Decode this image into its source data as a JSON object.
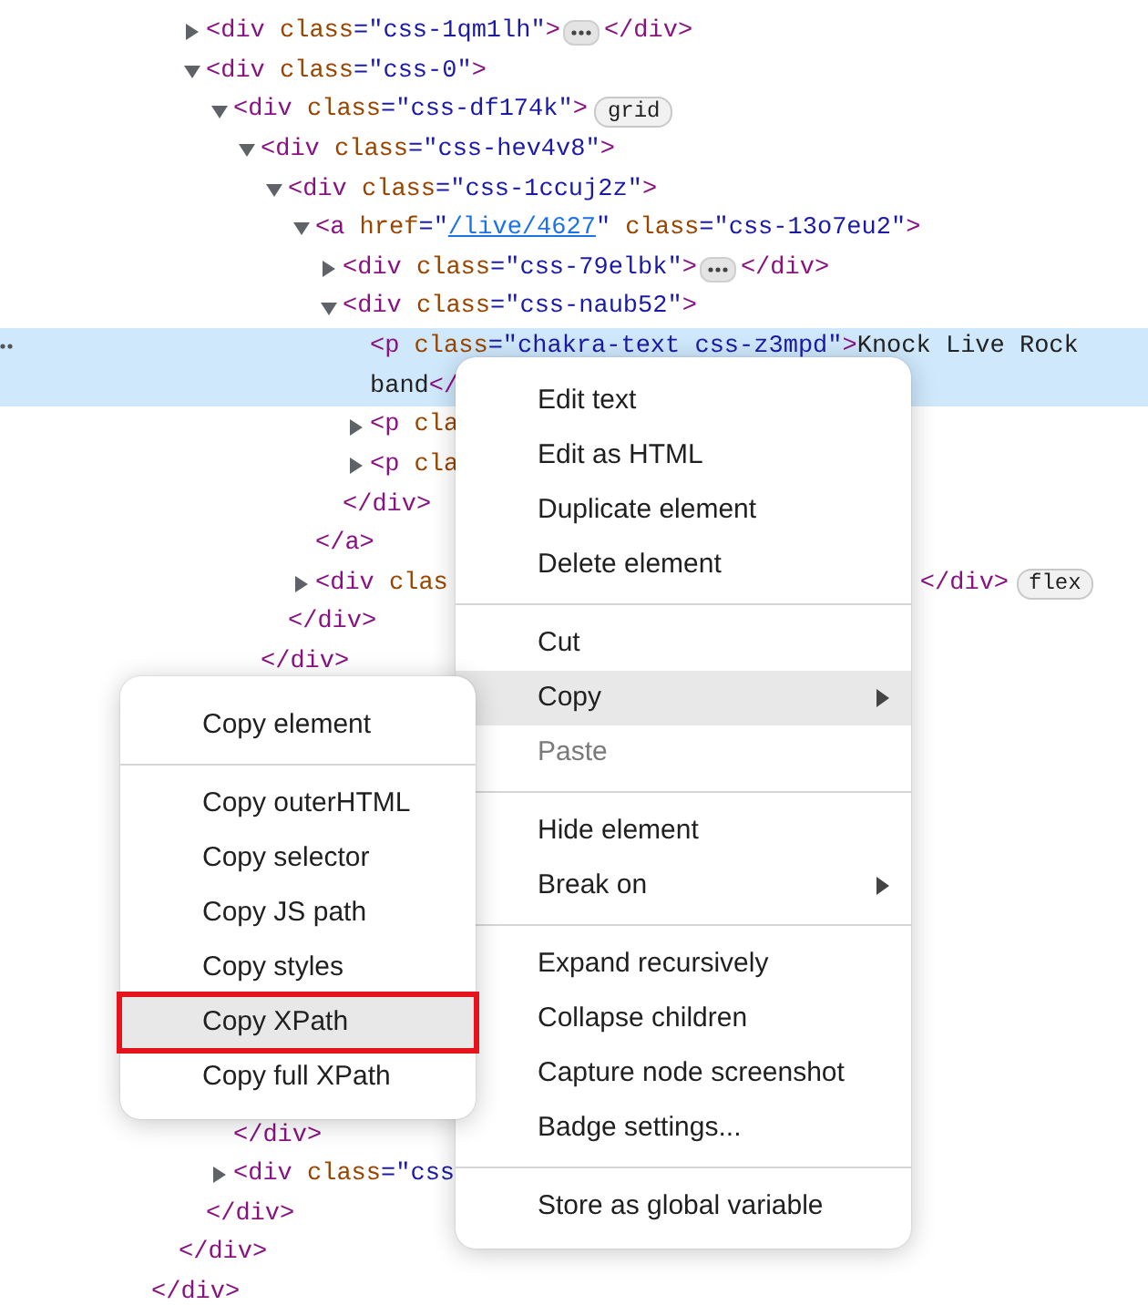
{
  "dom_tree": {
    "closing": "</div>",
    "children": [
      {
        "closing": "</div>",
        "children": [
          {
            "selected": false,
            "expanded": false,
            "parts": [
              {
                "kind": "tag",
                "text": "<div"
              },
              {
                "kind": "attr",
                "text": " class"
              },
              {
                "kind": "val",
                "text": "=\"css-1qm1lh\""
              },
              {
                "kind": "tag",
                "text": ">"
              },
              {
                "kind": "more"
              },
              {
                "kind": "tag",
                "text": "</div>"
              }
            ]
          },
          {
            "selected": false,
            "expanded": true,
            "parts": [
              {
                "kind": "tag",
                "text": "<div"
              },
              {
                "kind": "attr",
                "text": " class"
              },
              {
                "kind": "val",
                "text": "=\"css-0\""
              },
              {
                "kind": "tag",
                "text": ">"
              }
            ],
            "closing": "</div>",
            "children": [
              {
                "selected": false,
                "expanded": true,
                "more_hidden": true,
                "parts": [
                  {
                    "kind": "tag",
                    "text": "<div"
                  },
                  {
                    "kind": "attr",
                    "text": " class"
                  },
                  {
                    "kind": "val",
                    "text": "=\"css-df174k\""
                  },
                  {
                    "kind": "tag",
                    "text": ">"
                  },
                  {
                    "kind": "badge",
                    "text": "grid"
                  }
                ],
                "closing": "</div>",
                "children": [
                  {
                    "selected": false,
                    "expanded": true,
                    "parts": [
                      {
                        "kind": "tag",
                        "text": "<div"
                      },
                      {
                        "kind": "attr",
                        "text": " class"
                      },
                      {
                        "kind": "val",
                        "text": "=\"css-hev4v8\""
                      },
                      {
                        "kind": "tag",
                        "text": ">"
                      }
                    ],
                    "closing": "</div>",
                    "children": [
                      {
                        "selected": false,
                        "expanded": true,
                        "parts": [
                          {
                            "kind": "tag",
                            "text": "<div"
                          },
                          {
                            "kind": "attr",
                            "text": " class"
                          },
                          {
                            "kind": "val",
                            "text": "=\"css-1ccuj2z\""
                          },
                          {
                            "kind": "tag",
                            "text": ">"
                          }
                        ],
                        "closing": "</div>",
                        "children": [
                          {
                            "selected": false,
                            "expanded": true,
                            "parts": [
                              {
                                "kind": "tag",
                                "text": "<a"
                              },
                              {
                                "kind": "attr",
                                "text": " href"
                              },
                              {
                                "kind": "val",
                                "text": "=\""
                              },
                              {
                                "kind": "link",
                                "text": "/live/4627"
                              },
                              {
                                "kind": "val",
                                "text": "\""
                              },
                              {
                                "kind": "attr",
                                "text": " class"
                              },
                              {
                                "kind": "val",
                                "text": "=\"css-13o7eu2\""
                              },
                              {
                                "kind": "tag",
                                "text": ">"
                              }
                            ],
                            "closing": "</a>",
                            "children": [
                              {
                                "selected": false,
                                "expanded": false,
                                "parts": [
                                  {
                                    "kind": "tag",
                                    "text": "<div"
                                  },
                                  {
                                    "kind": "attr",
                                    "text": " class"
                                  },
                                  {
                                    "kind": "val",
                                    "text": "=\"css-79elbk\""
                                  },
                                  {
                                    "kind": "tag",
                                    "text": ">"
                                  },
                                  {
                                    "kind": "more"
                                  },
                                  {
                                    "kind": "tag",
                                    "text": "</div>"
                                  }
                                ]
                              },
                              {
                                "selected": false,
                                "expanded": true,
                                "parts": [
                                  {
                                    "kind": "tag",
                                    "text": "<div"
                                  },
                                  {
                                    "kind": "attr",
                                    "text": " class"
                                  },
                                  {
                                    "kind": "val",
                                    "text": "=\"css-naub52\""
                                  },
                                  {
                                    "kind": "tag",
                                    "text": ">"
                                  }
                                ],
                                "closing": "</div>",
                                "children": [
                                  {
                                    "selected": true,
                                    "parts": [
                                      {
                                        "kind": "tag",
                                        "text": "<p"
                                      },
                                      {
                                        "kind": "attr",
                                        "text": " class"
                                      },
                                      {
                                        "kind": "val",
                                        "text": "=\"chakra-text css-z3mpd\""
                                      },
                                      {
                                        "kind": "tag",
                                        "text": ">"
                                      },
                                      {
                                        "kind": "text",
                                        "text": "Knock Live Rock band"
                                      },
                                      {
                                        "kind": "tag",
                                        "text": "</"
                                      }
                                    ]
                                  },
                                  {
                                    "selected": false,
                                    "expanded": false,
                                    "parts": [
                                      {
                                        "kind": "tag",
                                        "text": "<p"
                                      },
                                      {
                                        "kind": "attr",
                                        "text": " cla"
                                      }
                                    ]
                                  },
                                  {
                                    "selected": false,
                                    "expanded": false,
                                    "parts": [
                                      {
                                        "kind": "tag",
                                        "text": "<p"
                                      },
                                      {
                                        "kind": "attr",
                                        "text": " cla"
                                      }
                                    ]
                                  }
                                ]
                              }
                            ]
                          },
                          {
                            "selected": false,
                            "expanded": false,
                            "parts": [
                              {
                                "kind": "tag",
                                "text": "<div"
                              },
                              {
                                "kind": "attr",
                                "text": " clas"
                              },
                              {
                                "kind": "covered"
                              },
                              {
                                "kind": "tag",
                                "text": "</div>"
                              },
                              {
                                "kind": "badge",
                                "text": "flex"
                              }
                            ]
                          }
                        ]
                      }
                    ]
                  }
                ]
              },
              {
                "selected": false,
                "expanded": false,
                "parts": [
                  {
                    "kind": "tag",
                    "text": "<div"
                  },
                  {
                    "kind": "attr",
                    "text": " class"
                  },
                  {
                    "kind": "val",
                    "text": "=\"css"
                  }
                ]
              }
            ]
          }
        ]
      }
    ]
  },
  "context_menu": {
    "groups": [
      [
        {
          "label": "Edit text",
          "selected": false,
          "disabled": false,
          "has_submenu": false
        },
        {
          "label": "Edit as HTML",
          "selected": false,
          "disabled": false,
          "has_submenu": false
        },
        {
          "label": "Duplicate element",
          "selected": false,
          "disabled": false,
          "has_submenu": false
        },
        {
          "label": "Delete element",
          "selected": false,
          "disabled": false,
          "has_submenu": false
        }
      ],
      [
        {
          "label": "Cut",
          "selected": false,
          "disabled": false,
          "has_submenu": false
        },
        {
          "label": "Copy",
          "selected": true,
          "disabled": false,
          "has_submenu": true
        },
        {
          "label": "Paste",
          "selected": false,
          "disabled": true,
          "has_submenu": false
        }
      ],
      [
        {
          "label": "Hide element",
          "selected": false,
          "disabled": false,
          "has_submenu": false
        },
        {
          "label": "Break on",
          "selected": false,
          "disabled": false,
          "has_submenu": true
        }
      ],
      [
        {
          "label": "Expand recursively",
          "selected": false,
          "disabled": false,
          "has_submenu": false
        },
        {
          "label": "Collapse children",
          "selected": false,
          "disabled": false,
          "has_submenu": false
        },
        {
          "label": "Capture node screenshot",
          "selected": false,
          "disabled": false,
          "has_submenu": false
        },
        {
          "label": "Badge settings...",
          "selected": false,
          "disabled": false,
          "has_submenu": false
        }
      ],
      [
        {
          "label": "Store as global variable",
          "selected": false,
          "disabled": false,
          "has_submenu": false
        }
      ]
    ]
  },
  "copy_submenu": {
    "groups": [
      [
        {
          "label": "Copy element",
          "selected": false,
          "outlined": false
        }
      ],
      [
        {
          "label": "Copy outerHTML",
          "selected": false,
          "outlined": false
        },
        {
          "label": "Copy selector",
          "selected": false,
          "outlined": false
        },
        {
          "label": "Copy JS path",
          "selected": false,
          "outlined": false
        },
        {
          "label": "Copy styles",
          "selected": false,
          "outlined": false
        },
        {
          "label": "Copy XPath",
          "selected": true,
          "outlined": true
        },
        {
          "label": "Copy full XPath",
          "selected": false,
          "outlined": false
        }
      ]
    ]
  }
}
